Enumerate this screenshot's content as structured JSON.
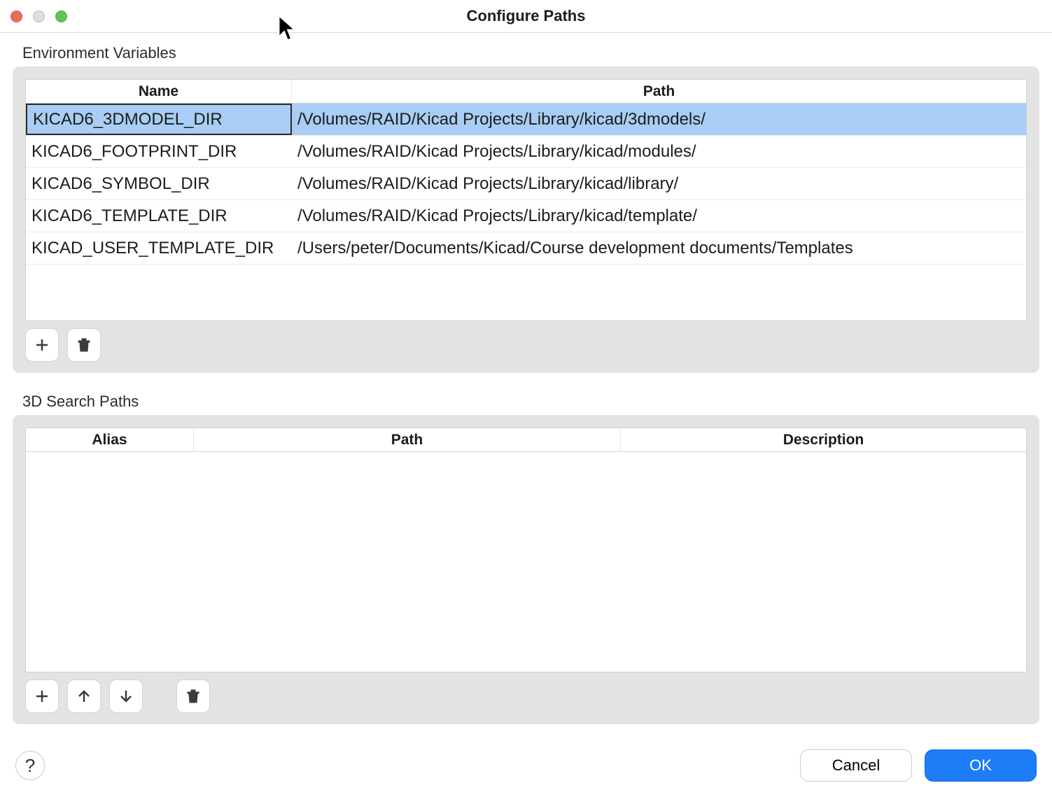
{
  "window": {
    "title": "Configure Paths"
  },
  "env_section": {
    "label": "Environment Variables",
    "columns": {
      "name": "Name",
      "path": "Path"
    },
    "selected_index": 0,
    "rows": [
      {
        "name": "KICAD6_3DMODEL_DIR",
        "path": "/Volumes/RAID/Kicad Projects/Library/kicad/3dmodels/"
      },
      {
        "name": "KICAD6_FOOTPRINT_DIR",
        "path": "/Volumes/RAID/Kicad Projects/Library/kicad/modules/"
      },
      {
        "name": "KICAD6_SYMBOL_DIR",
        "path": "/Volumes/RAID/Kicad Projects/Library/kicad/library/"
      },
      {
        "name": "KICAD6_TEMPLATE_DIR",
        "path": "/Volumes/RAID/Kicad Projects/Library/kicad/template/"
      },
      {
        "name": "KICAD_USER_TEMPLATE_DIR",
        "path": "/Users/peter/Documents/Kicad/Course development documents/Templates"
      }
    ],
    "buttons": {
      "add": "add",
      "delete": "delete"
    }
  },
  "search_section": {
    "label": "3D Search Paths",
    "columns": {
      "alias": "Alias",
      "path": "Path",
      "description": "Description"
    },
    "rows": [],
    "buttons": {
      "add": "add",
      "up": "move-up",
      "down": "move-down",
      "delete": "delete"
    }
  },
  "footer": {
    "help": "?",
    "cancel": "Cancel",
    "ok": "OK"
  }
}
